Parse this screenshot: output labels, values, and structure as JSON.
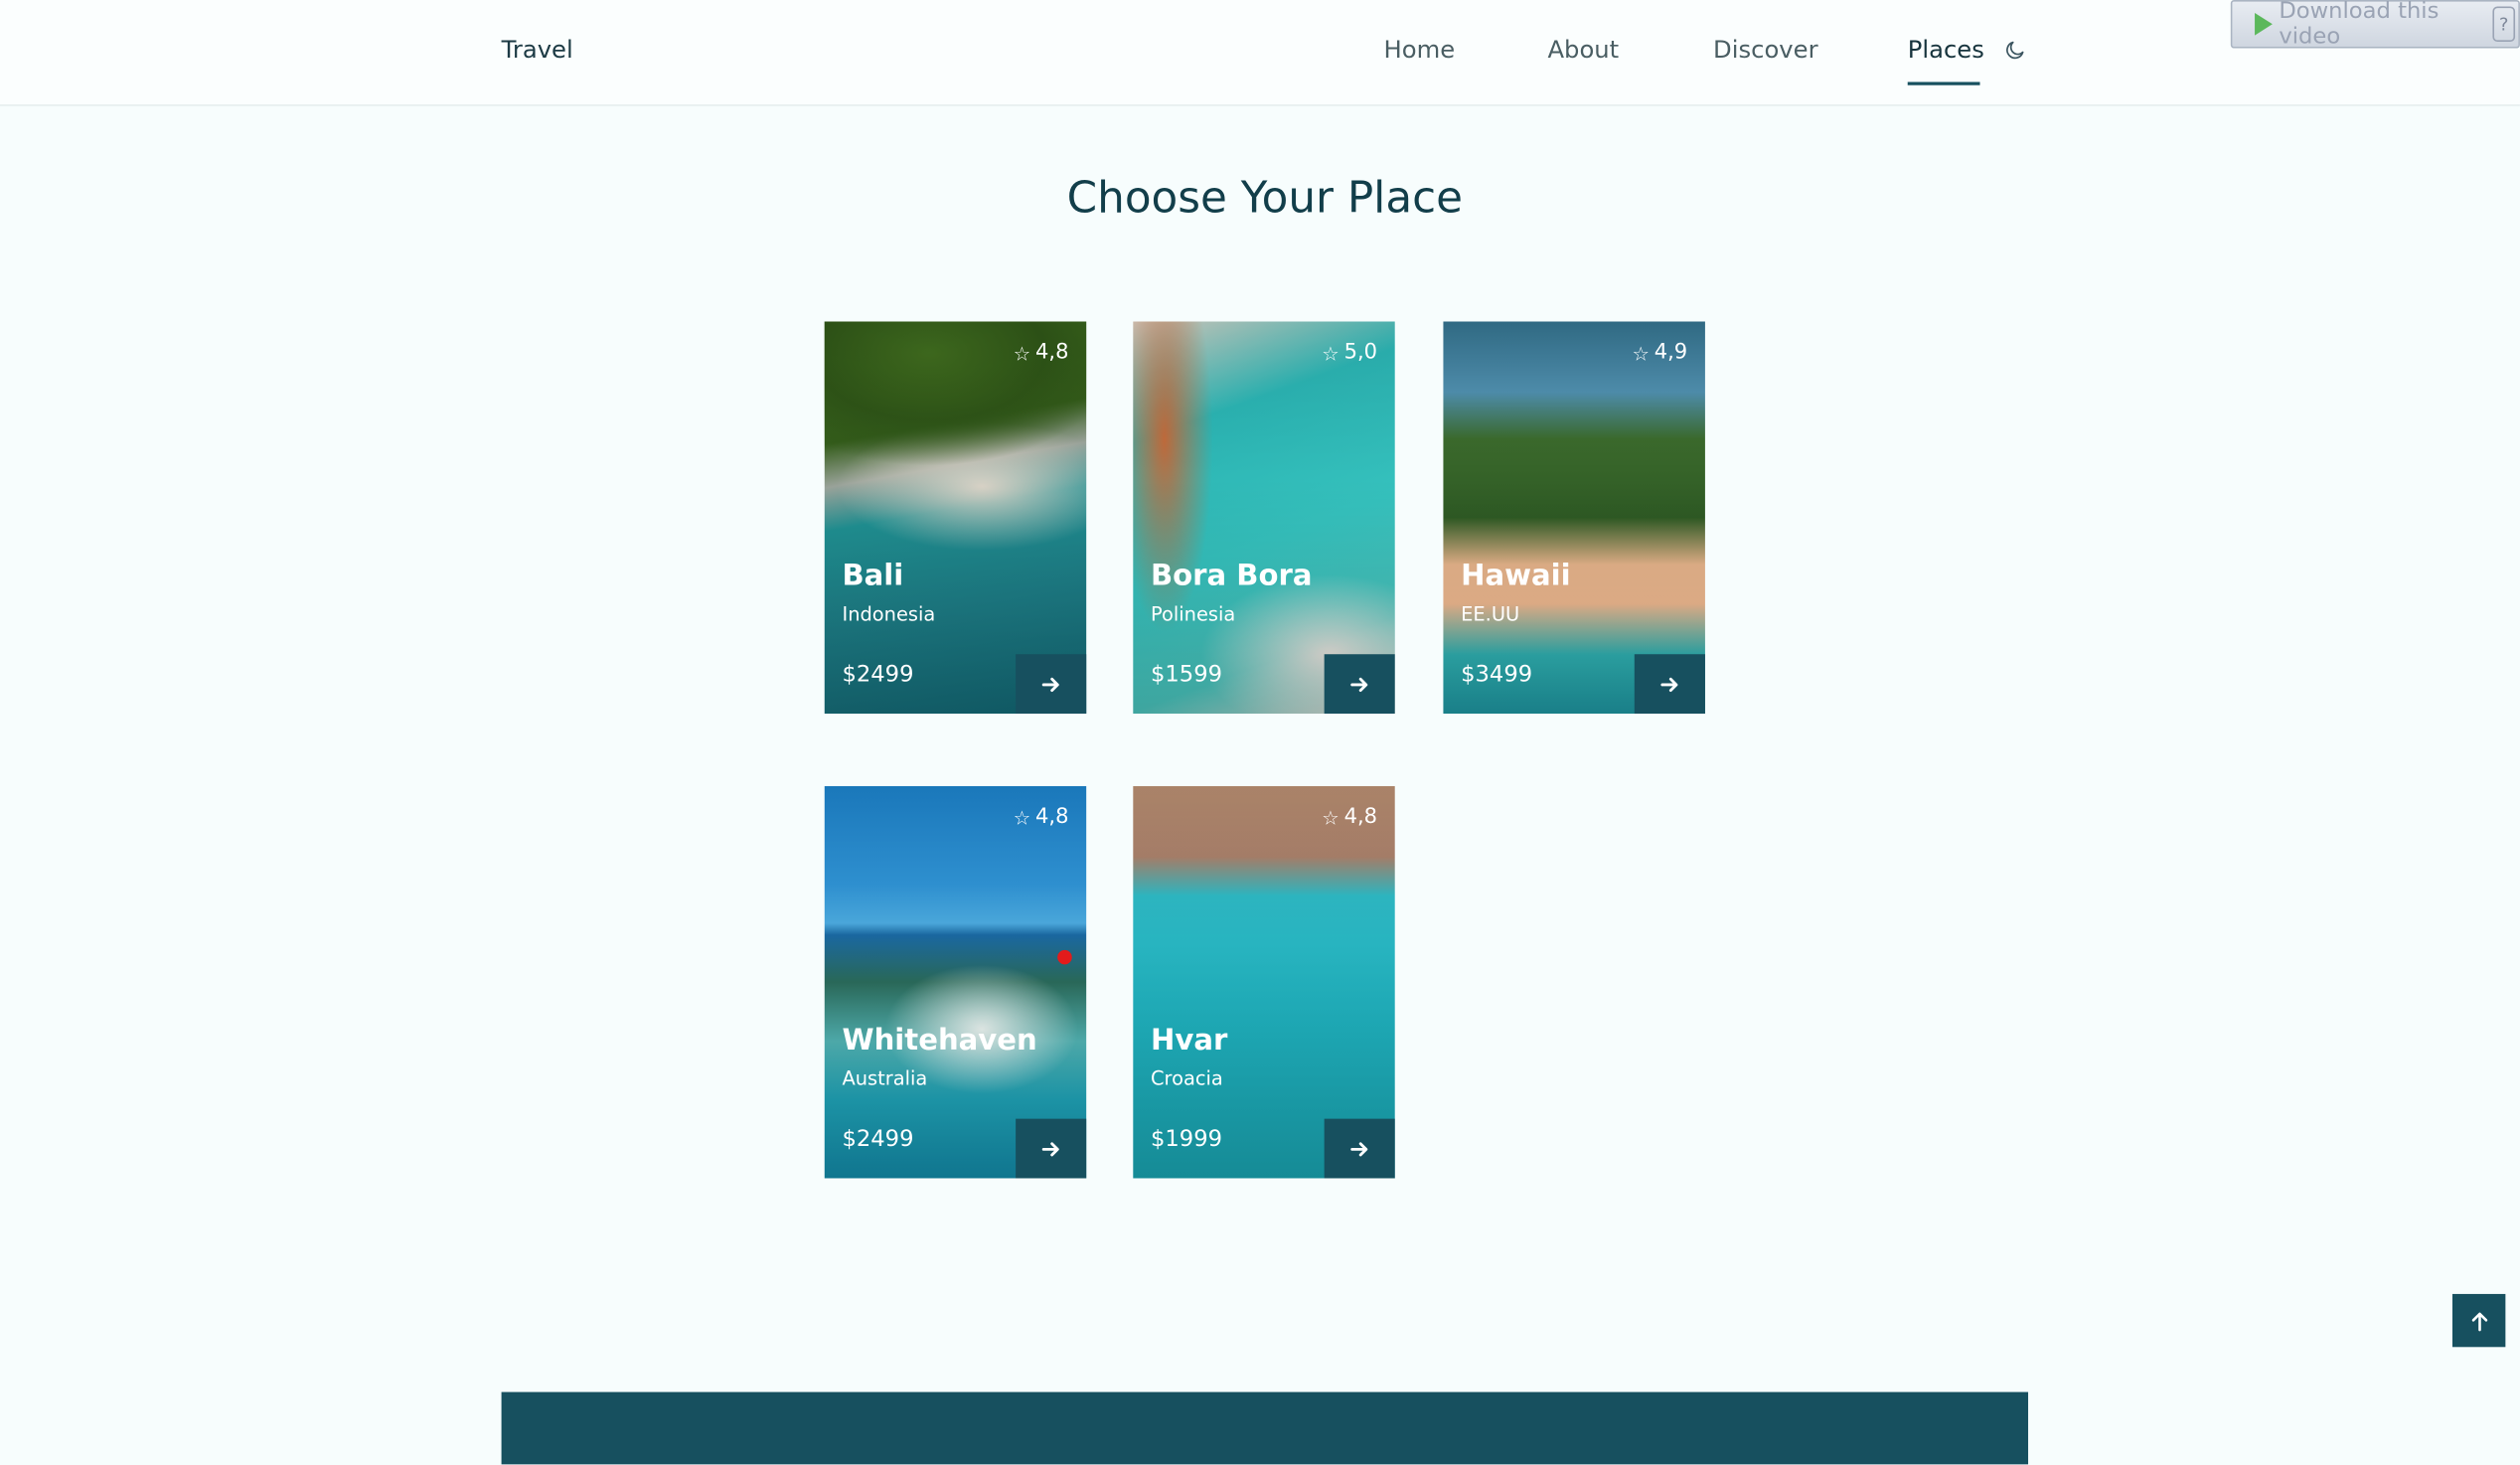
{
  "header": {
    "logo": "Travel",
    "nav": [
      "Home",
      "About",
      "Discover",
      "Places"
    ],
    "active_nav": "Places",
    "theme_icon": "moon-icon"
  },
  "download_widget": {
    "label": "Download this video",
    "help": "?"
  },
  "section": {
    "title": "Choose Your Place"
  },
  "places": [
    {
      "name": "Bali",
      "country": "Indonesia",
      "price": "$2499",
      "rating": "4,8"
    },
    {
      "name": "Bora Bora",
      "country": "Polinesia",
      "price": "$1599",
      "rating": "5,0"
    },
    {
      "name": "Hawaii",
      "country": "EE.UU",
      "price": "$3499",
      "rating": "4,9"
    },
    {
      "name": "Whitehaven",
      "country": "Australia",
      "price": "$2499",
      "rating": "4,8"
    },
    {
      "name": "Hvar",
      "country": "Croacia",
      "price": "$1999",
      "rating": "4,8"
    }
  ],
  "colors": {
    "primary": "#17505f",
    "background": "#f7fdfd",
    "title": "#123e4a"
  }
}
